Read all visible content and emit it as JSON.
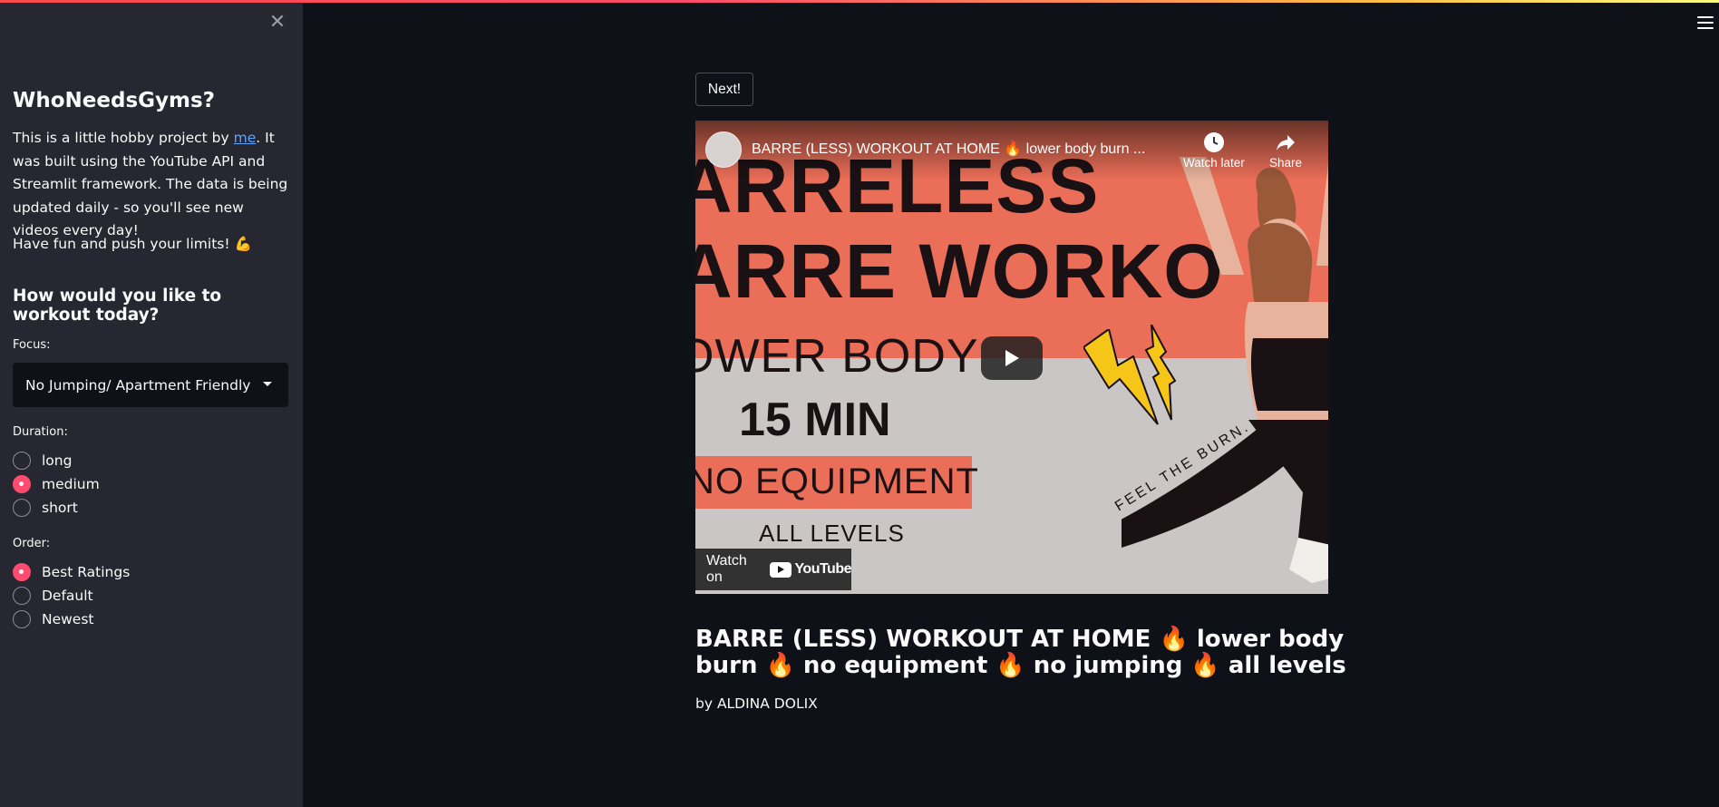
{
  "app": {
    "accent_color": "#ff4b6e",
    "background_color": "#0e1117",
    "sidebar_color": "#262730"
  },
  "sidebar": {
    "close_icon": "close-icon",
    "title": "WhoNeedsGyms?",
    "intro_before_link": "This is a little hobby project by ",
    "intro_link": "me",
    "intro_after_link": ". It was built using the YouTube API and Streamlit framework. The data is being updated daily - so you'll see new videos every day!",
    "fun_text": "Have fun and push your limits! 💪",
    "question": "How would you like to workout today?",
    "focus": {
      "label": "Focus:",
      "selected": "No Jumping/ Apartment Friendly"
    },
    "duration": {
      "label": "Duration:",
      "options": [
        "long",
        "medium",
        "short"
      ],
      "selected": "medium"
    },
    "order": {
      "label": "Order:",
      "options": [
        "Best Ratings",
        "Default",
        "Newest"
      ],
      "selected": "Best Ratings"
    }
  },
  "main": {
    "menu_icon": "hamburger-menu-icon",
    "next_label": "Next!",
    "video": {
      "player_title": "BARRE (LESS) WORKOUT AT HOME 🔥 lower body burn ...",
      "watch_later_label": "Watch later",
      "share_label": "Share",
      "watch_on_label": "Watch on",
      "youtube_label": "YouTube",
      "thumbnail_lines": [
        "ARRELESS",
        "ARRE WORKO",
        "OWER BODY",
        "15 MIN",
        "NO EQUIPMENT",
        "ALL LEVELS"
      ],
      "thumbnail_tagline": "FEEL THE BURN."
    },
    "title": "BARRE (LESS) WORKOUT AT HOME 🔥 lower body burn 🔥 no equipment 🔥 no jumping 🔥 all levels",
    "author": "by ALDINA DOLIX"
  }
}
